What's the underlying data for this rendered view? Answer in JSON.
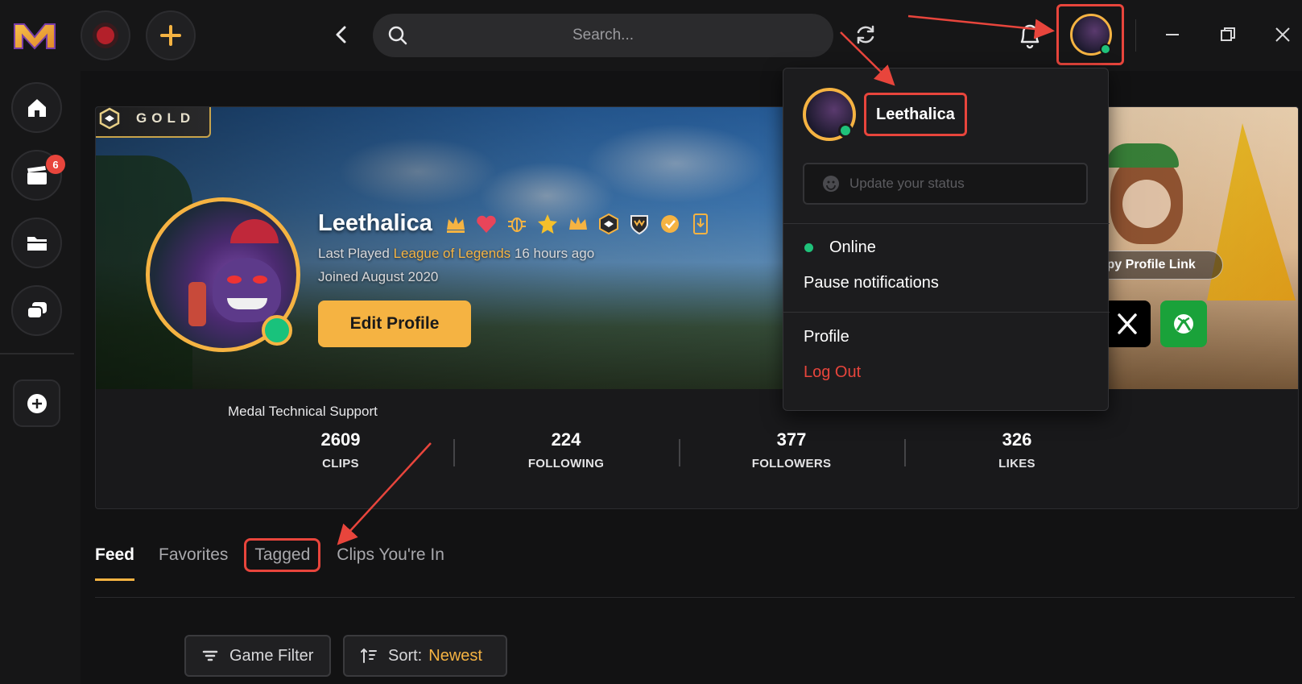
{
  "app": {
    "name": "Medal",
    "brand_color": "#f5b342",
    "accent_red": "#e8453c"
  },
  "topbar": {
    "search_placeholder": "Search...",
    "icons": [
      "medal-logo-icon",
      "record-icon",
      "plus-icon",
      "chevron-left-icon",
      "search-icon",
      "refresh-icon",
      "bell-icon",
      "avatar",
      "minimize-icon",
      "maximize-icon",
      "close-icon"
    ]
  },
  "sidebar": {
    "items": [
      {
        "name": "home",
        "icon": "home-icon"
      },
      {
        "name": "clips",
        "icon": "clapperboard-icon",
        "badge": "6"
      },
      {
        "name": "folder",
        "icon": "folder-icon"
      },
      {
        "name": "chat",
        "icon": "chat-icon"
      }
    ],
    "add_icon": "plus-circle-icon"
  },
  "profile": {
    "tier": "GOLD",
    "username": "Leethalica",
    "last_played_prefix": "Last Played",
    "last_played_game": "League of Legends",
    "last_played_suffix": "16 hours ago",
    "joined": "Joined August 2020",
    "edit_label": "Edit Profile",
    "copy_link_label": "Copy Profile Link",
    "bio": "Medal Technical Support",
    "stats": [
      {
        "value": "2609",
        "label": "CLIPS"
      },
      {
        "value": "224",
        "label": "FOLLOWING"
      },
      {
        "value": "377",
        "label": "FOLLOWERS"
      },
      {
        "value": "326",
        "label": "LIKES"
      }
    ]
  },
  "tabs": [
    {
      "label": "Feed",
      "active": true
    },
    {
      "label": "Favorites",
      "active": false
    },
    {
      "label": "Tagged",
      "active": false
    },
    {
      "label": "Clips You're In",
      "active": false
    }
  ],
  "filters": {
    "game_filter_label": "Game Filter",
    "sort_prefix": "Sort:",
    "sort_value": "Newest"
  },
  "dropdown": {
    "username": "Leethalica",
    "status_placeholder": "Update your status",
    "online_label": "Online",
    "pause_label": "Pause notifications",
    "profile_label": "Profile",
    "logout_label": "Log Out"
  }
}
